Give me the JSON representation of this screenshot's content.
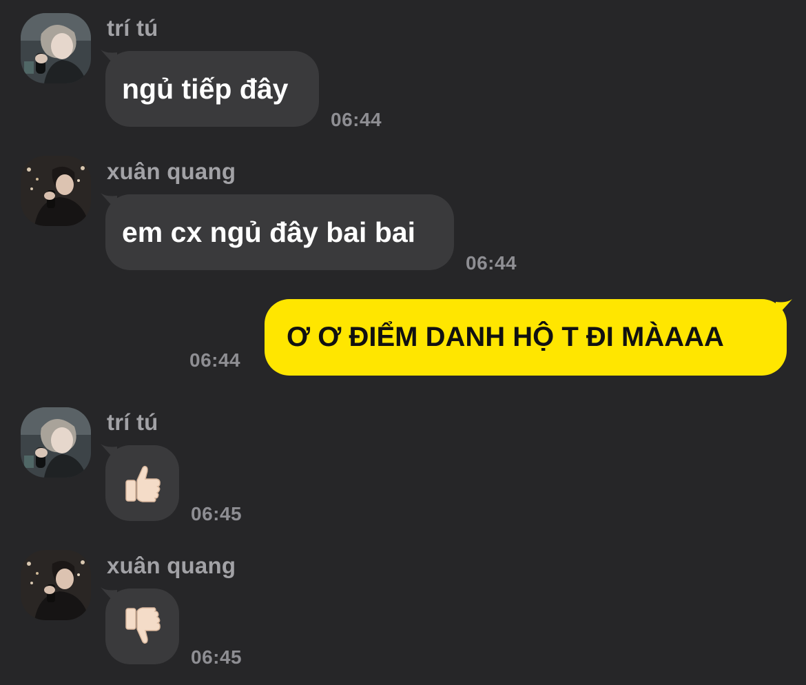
{
  "messages": [
    {
      "sender": "trí tú",
      "text": "ngủ tiếp đây",
      "time": "06:44",
      "direction": "incoming",
      "avatar": "avatar-tri-tu"
    },
    {
      "sender": "xuân quang",
      "text": "em cx ngủ đây bai bai",
      "time": "06:44",
      "direction": "incoming",
      "avatar": "avatar-xuan-quang"
    },
    {
      "text": "Ơ Ơ ĐIỂM DANH HỘ T ĐI MÀAAA",
      "time": "06:44",
      "direction": "outgoing"
    },
    {
      "sender": "trí tú",
      "text": "👍🏻",
      "time": "06:45",
      "direction": "incoming",
      "avatar": "avatar-tri-tu",
      "icon": "thumbs-up-icon"
    },
    {
      "sender": "xuân quang",
      "text": "👎🏻",
      "time": "06:45",
      "direction": "incoming",
      "avatar": "avatar-xuan-quang",
      "icon": "thumbs-down-icon"
    }
  ],
  "colors": {
    "background": "#262628",
    "incoming_bubble": "#3a3a3c",
    "outgoing_bubble": "#ffe600",
    "name_text": "#a2a2a6",
    "time_text": "#8e8e93"
  }
}
